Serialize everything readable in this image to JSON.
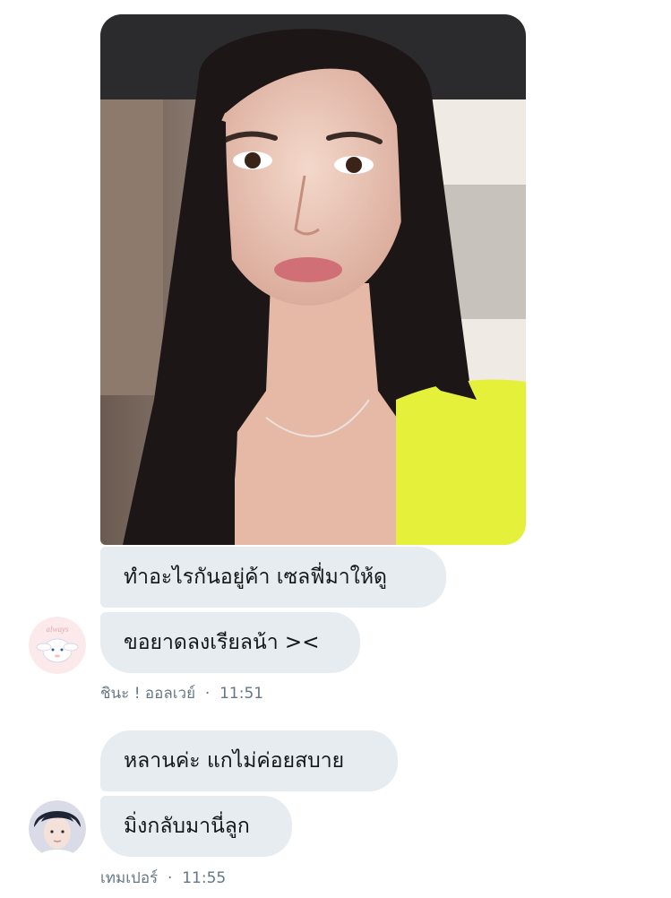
{
  "conversation": {
    "messages": [
      {
        "text": "ทำอะไรกันอยู่ค้า เซลฟี่มาให้ดู"
      },
      {
        "text": "ขอยาดลงเรียลน้า ><"
      },
      {
        "text": "หลานค่ะ แกไม่ค่อยสบาย"
      },
      {
        "text": "มิ่งกลับมานี่ลูก"
      }
    ],
    "groups": [
      {
        "sender": "ชินะ ! ออลเวย์",
        "time": "11:51",
        "avatar_text": "always"
      },
      {
        "sender": "เทมเปอร์",
        "time": "11:55"
      }
    ]
  },
  "colors": {
    "bubble": "#e6ecf0",
    "meta_text": "#657786",
    "text": "#14171a"
  }
}
